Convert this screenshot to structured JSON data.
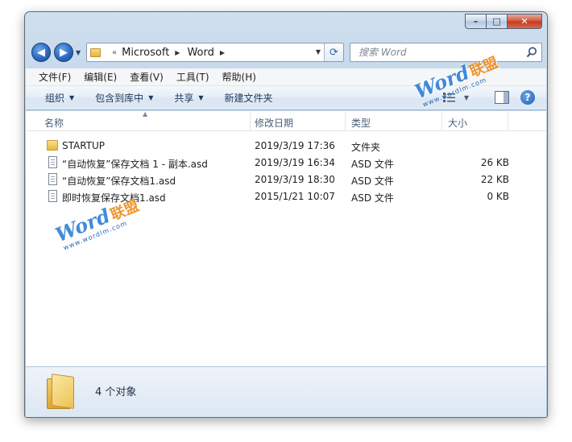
{
  "window": {
    "caption": {
      "minimize": "–",
      "maximize": "□",
      "close": "✕"
    }
  },
  "navigation": {
    "back": "◀",
    "forward": "▶",
    "breadcrumb_overflow": "«",
    "breadcrumb": [
      "Microsoft",
      "Word"
    ],
    "search_placeholder": "搜索 Word"
  },
  "menu": [
    "文件(F)",
    "编辑(E)",
    "查看(V)",
    "工具(T)",
    "帮助(H)"
  ],
  "commands": [
    {
      "label": "组织",
      "dropdown": true
    },
    {
      "label": "包含到库中",
      "dropdown": true
    },
    {
      "label": "共享",
      "dropdown": true
    },
    {
      "label": "新建文件夹",
      "dropdown": false
    }
  ],
  "columns": {
    "name": "名称",
    "modified": "修改日期",
    "type": "类型",
    "size": "大小"
  },
  "files": [
    {
      "name": "STARTUP",
      "modified": "2019/3/19 17:36",
      "type": "文件夹",
      "size": "",
      "icon": "folder-icon"
    },
    {
      "name": "“自动恢复”保存文档 1 - 副本.asd",
      "modified": "2019/3/19 16:34",
      "type": "ASD 文件",
      "size": "26 KB",
      "icon": "file-icon"
    },
    {
      "name": "“自动恢复”保存文档1.asd",
      "modified": "2019/3/19 18:30",
      "type": "ASD 文件",
      "size": "22 KB",
      "icon": "file-icon"
    },
    {
      "name": "即时恢复保存文档1.asd",
      "modified": "2015/1/21 10:07",
      "type": "ASD 文件",
      "size": "0 KB",
      "icon": "file-icon"
    }
  ],
  "status": {
    "item_count": "4 个对象"
  },
  "watermark": {
    "brand": "Word",
    "cn": "联盟",
    "url": "www.wordlm.com"
  },
  "colors": {
    "titlebar": "#b9d0e6",
    "close_button": "#c23a20",
    "accent": "#2a69c4"
  }
}
